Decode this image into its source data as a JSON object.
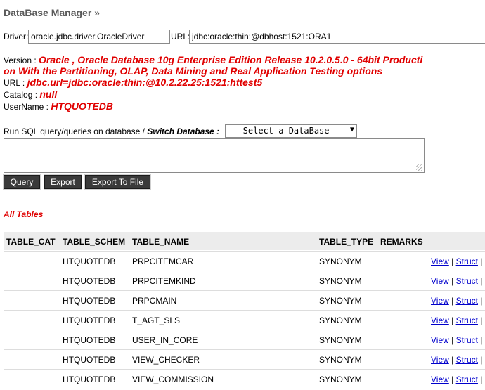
{
  "header": {
    "title": "DataBase Manager »"
  },
  "connection": {
    "driver_label": "Driver:",
    "driver_value": "oracle.jdbc.driver.OracleDriver",
    "url_label": "URL:",
    "url_value": "jdbc:oracle:thin:@dbhost:1521:ORA1"
  },
  "info": {
    "version_label": "Version :",
    "version_line1": "Oracle , Oracle Database 10g Enterprise Edition Release 10.2.0.5.0 - 64bit Producti",
    "version_line2": "on With the Partitioning, OLAP, Data Mining and Real Application Testing options",
    "url_label": "URL :",
    "url_value": "jdbc.url=jdbc:oracle:thin:@10.2.22.25:1521:httest5",
    "catalog_label": "Catalog :",
    "catalog_value": "null",
    "username_label": "UserName :",
    "username_value": "HTQUOTEDB"
  },
  "sql": {
    "prompt": "Run SQL query/queries on database / ",
    "switch_label": "Switch Database :",
    "select_value": "-- Select a DataBase --",
    "query_text": ""
  },
  "buttons": {
    "query": "Query",
    "export": "Export",
    "export_to_file": "Export To File"
  },
  "tables": {
    "title": "All Tables",
    "columns": [
      "TABLE_CAT",
      "TABLE_SCHEM",
      "TABLE_NAME",
      "TABLE_TYPE",
      "REMARKS"
    ],
    "link_view": "View",
    "link_struct": "Struct",
    "separator": "|",
    "rows": [
      {
        "cat": "",
        "schem": "HTQUOTEDB",
        "name": "PRPCITEMCAR",
        "type": "SYNONYM",
        "remarks": ""
      },
      {
        "cat": "",
        "schem": "HTQUOTEDB",
        "name": "PRPCITEMKIND",
        "type": "SYNONYM",
        "remarks": ""
      },
      {
        "cat": "",
        "schem": "HTQUOTEDB",
        "name": "PRPCMAIN",
        "type": "SYNONYM",
        "remarks": ""
      },
      {
        "cat": "",
        "schem": "HTQUOTEDB",
        "name": "T_AGT_SLS",
        "type": "SYNONYM",
        "remarks": ""
      },
      {
        "cat": "",
        "schem": "HTQUOTEDB",
        "name": "USER_IN_CORE",
        "type": "SYNONYM",
        "remarks": ""
      },
      {
        "cat": "",
        "schem": "HTQUOTEDB",
        "name": "VIEW_CHECKER",
        "type": "SYNONYM",
        "remarks": ""
      },
      {
        "cat": "",
        "schem": "HTQUOTEDB",
        "name": "VIEW_COMMISSION",
        "type": "SYNONYM",
        "remarks": ""
      }
    ]
  }
}
